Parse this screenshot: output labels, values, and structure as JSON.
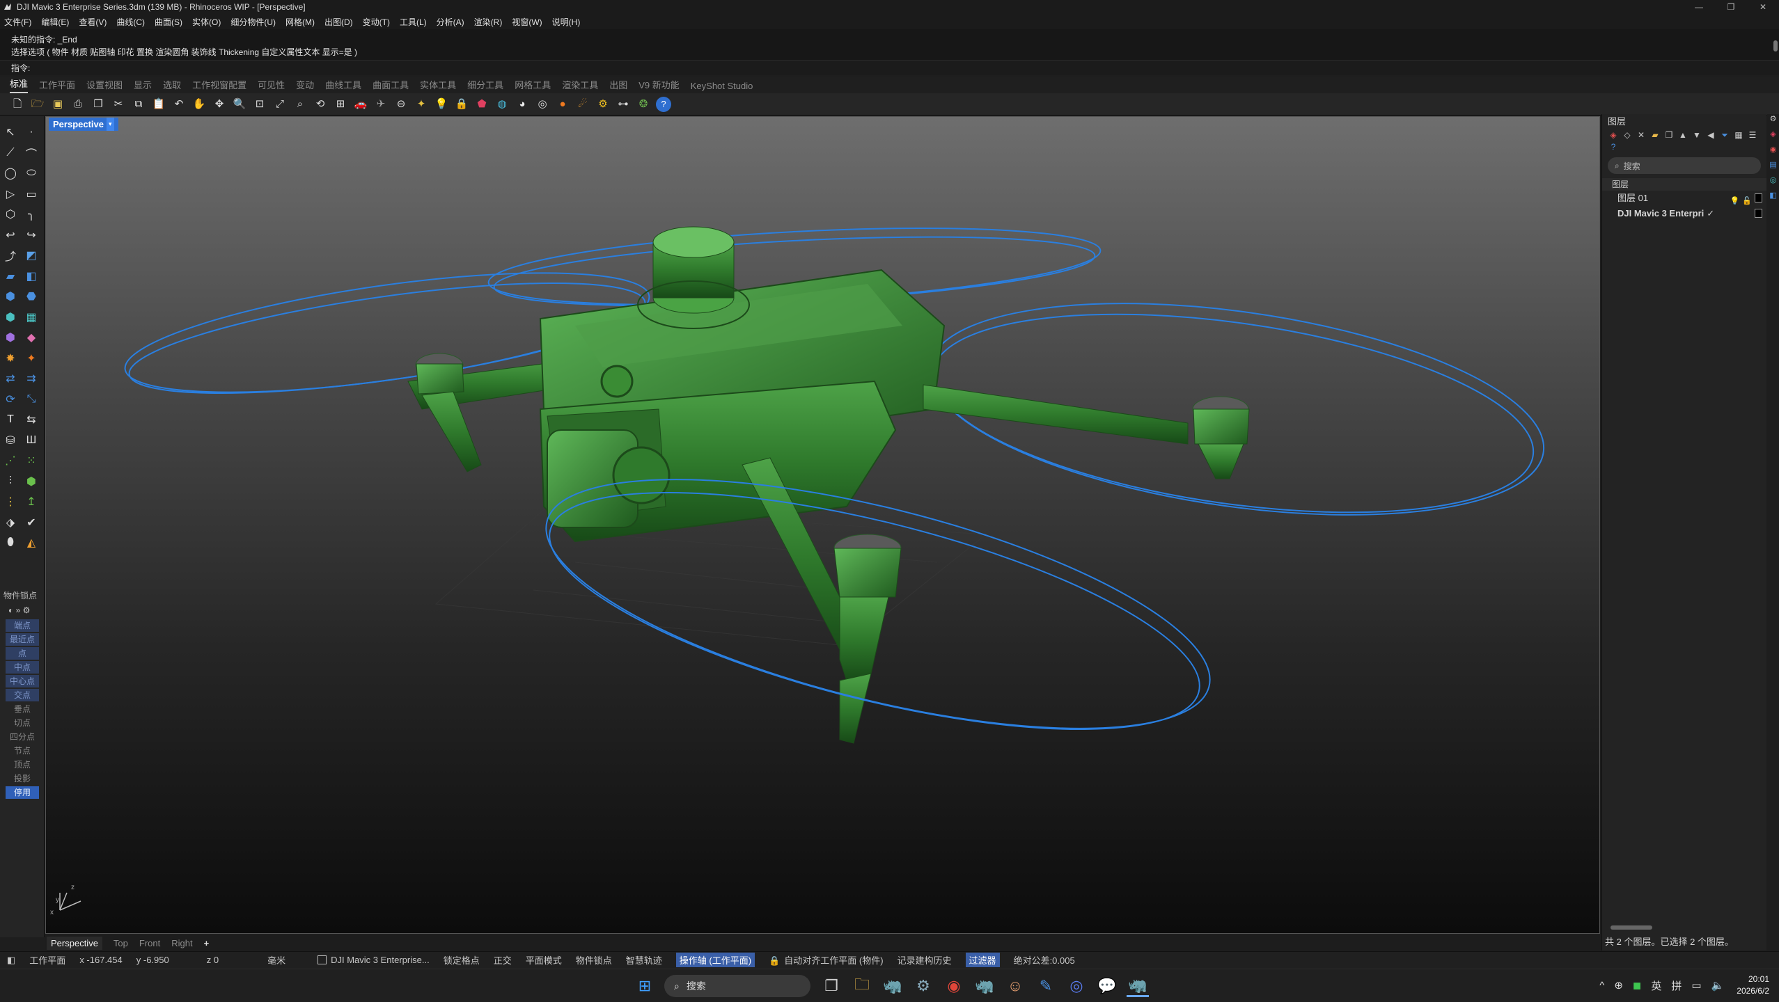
{
  "window": {
    "title": "DJI Mavic 3 Enterprise Series.3dm (139 MB) - Rhinoceros WIP - [Perspective]",
    "minimize": "—",
    "maximize": "❐",
    "close": "✕"
  },
  "menu": [
    "文件(F)",
    "编辑(E)",
    "查看(V)",
    "曲线(C)",
    "曲面(S)",
    "实体(O)",
    "细分物件(U)",
    "网格(M)",
    "出图(D)",
    "变动(T)",
    "工具(L)",
    "分析(A)",
    "渲染(R)",
    "视窗(W)",
    "说明(H)"
  ],
  "command": {
    "history1": "未知的指令: _End",
    "history2": "选择选项 ( 物件  材质  贴图轴  印花  置换  渲染圆角  装饰线  Thickening  自定义属性文本  显示=是 )",
    "prompt": "指令:"
  },
  "tabs": [
    "标准",
    "工作平面",
    "设置视图",
    "显示",
    "选取",
    "工作视窗配置",
    "可见性",
    "变动",
    "曲线工具",
    "曲面工具",
    "实体工具",
    "细分工具",
    "网格工具",
    "渲染工具",
    "出图",
    "V9 新功能",
    "KeyShot Studio"
  ],
  "viewport": {
    "name": "Perspective",
    "dropdown": "▾",
    "axis_x": "x",
    "axis_y": "y",
    "axis_z": "z"
  },
  "viewport_tabs": [
    "Perspective",
    "Top",
    "Front",
    "Right",
    "+"
  ],
  "osnap": {
    "title": "物件锁点",
    "controls": "◐ »  ⚙",
    "items": [
      {
        "label": "端点",
        "state": "on"
      },
      {
        "label": "最近点",
        "state": "on"
      },
      {
        "label": "点",
        "state": "on"
      },
      {
        "label": "中点",
        "state": "on"
      },
      {
        "label": "中心点",
        "state": "on"
      },
      {
        "label": "交点",
        "state": "on"
      },
      {
        "label": "垂点",
        "state": "off"
      },
      {
        "label": "切点",
        "state": "off"
      },
      {
        "label": "四分点",
        "state": "off"
      },
      {
        "label": "节点",
        "state": "off"
      },
      {
        "label": "顶点",
        "state": "off"
      },
      {
        "label": "投影",
        "state": "off"
      },
      {
        "label": "停用",
        "state": "enabled"
      }
    ]
  },
  "status": {
    "cplane": "工作平面",
    "x": "x -167.454",
    "y": "y -6.950",
    "z": "z 0",
    "unit": "毫米",
    "layer": "DJI Mavic 3 Enterprise...",
    "grid_snap": "锁定格点",
    "ortho": "正交",
    "planar": "平面模式",
    "osnap": "物件锁点",
    "smarttrack": "智慧轨迹",
    "gumball": "操作轴 (工作平面)",
    "autoalign": "自动对齐工作平面 (物件)",
    "history": "记录建构历史",
    "filter": "过滤器",
    "tolerance": "绝对公差:0.005"
  },
  "layers_panel": {
    "title": "图层",
    "search_placeholder": "搜索",
    "column": "图层",
    "layers": [
      {
        "name": "图层 01",
        "bold": false
      },
      {
        "name": "DJI Mavic 3 Enterpri",
        "bold": true
      }
    ],
    "footer": "共 2 个图层。已选择 2 个图层。"
  },
  "taskbar": {
    "search": "搜索",
    "tray": [
      "^",
      "⊕",
      "◼",
      "英",
      "拼",
      "▭",
      "🔈"
    ],
    "time": "20:01",
    "date": "2026/6/2"
  },
  "colors": {
    "accent": "#2f6fd0",
    "model_green": "#2f7a2c",
    "prop_ring": "#2a7fe0"
  }
}
